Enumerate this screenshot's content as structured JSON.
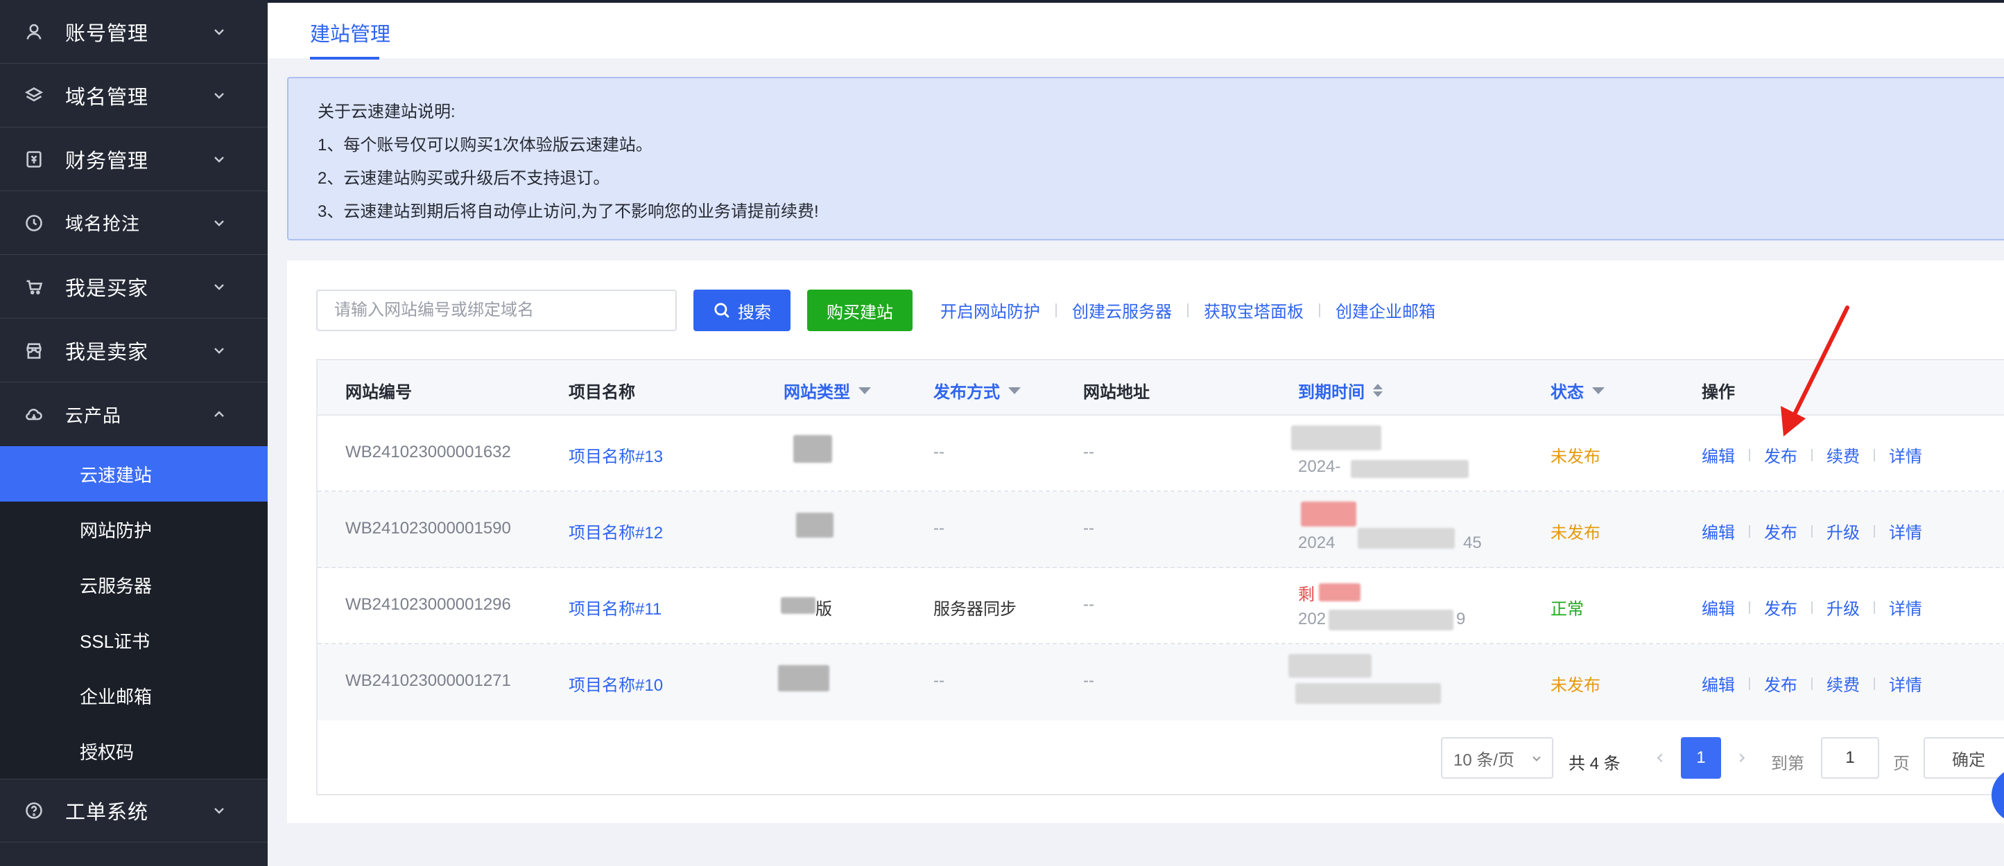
{
  "sidebar": {
    "items": [
      {
        "label": "账号管理",
        "icon": "user-icon"
      },
      {
        "label": "域名管理",
        "icon": "layers-icon"
      },
      {
        "label": "财务管理",
        "icon": "finance-icon"
      },
      {
        "label": "域名抢注",
        "icon": "clock-icon"
      },
      {
        "label": "我是买家",
        "icon": "cart-icon"
      },
      {
        "label": "我是卖家",
        "icon": "store-icon"
      },
      {
        "label": "云产品",
        "icon": "cloud-icon"
      }
    ],
    "sub_items": [
      "云速建站",
      "网站防护",
      "云服务器",
      "SSL证书",
      "企业邮箱",
      "授权码"
    ],
    "active_sub": "云速建站",
    "footer_item": {
      "label": "工单系统",
      "icon": "help-icon"
    }
  },
  "header": {
    "tab": "建站管理"
  },
  "notice": {
    "lines": [
      "关于云速建站说明:",
      "1、每个账号仅可以购买1次体验版云速建站。",
      "2、云速建站购买或升级后不支持退订。",
      "3、云速建站到期后将自动停止访问,为了不影响您的业务请提前续费!"
    ]
  },
  "toolbar": {
    "search_placeholder": "请输入网站编号或绑定域名",
    "search_label": "搜索",
    "buy_label": "购买建站",
    "links": [
      "开启网站防护",
      "创建云服务器",
      "获取宝塔面板",
      "创建企业邮箱"
    ]
  },
  "table": {
    "headers": [
      "网站编号",
      "项目名称",
      "网站类型",
      "发布方式",
      "网站地址",
      "到期时间",
      "状态",
      "操作"
    ],
    "rows": [
      {
        "id": "WB241023000001632",
        "name": "项目名称#13",
        "type": "",
        "publish": "--",
        "url": "--",
        "expire_line1": "",
        "expire_line2": "2024-",
        "status": "未发布",
        "status_color": "#e59a0e",
        "ops": [
          "编辑",
          "发布",
          "续费",
          "详情"
        ]
      },
      {
        "id": "WB241023000001590",
        "name": "项目名称#12",
        "type": "",
        "publish": "--",
        "url": "--",
        "expire_line1": "",
        "expire_line2": "2024",
        "expire_tail": "45",
        "status": "未发布",
        "status_color": "#e59a0e",
        "ops": [
          "编辑",
          "发布",
          "升级",
          "详情"
        ]
      },
      {
        "id": "WB241023000001296",
        "name": "项目名称#11",
        "type": "版",
        "publish": "服务器同步",
        "url": "--",
        "expire_line1": "剩",
        "expire_line2": "202",
        "expire_tail": "9",
        "status": "正常",
        "status_color": "#1eaa1e",
        "ops": [
          "编辑",
          "发布",
          "升级",
          "详情"
        ]
      },
      {
        "id": "WB241023000001271",
        "name": "项目名称#10",
        "type": "",
        "publish": "--",
        "url": "--",
        "expire_line1": "",
        "expire_line2": "",
        "status": "未发布",
        "status_color": "#e59a0e",
        "ops": [
          "编辑",
          "发布",
          "续费",
          "详情"
        ]
      }
    ]
  },
  "pagination": {
    "page_size": "10 条/页",
    "total": "共 4 条",
    "current": "1",
    "goto_label": "到第",
    "goto_value": "1",
    "page_label": "页",
    "confirm_label": "确定"
  },
  "colors": {
    "accent": "#2f64f0",
    "sidebar_bg": "#232834",
    "buy_green": "#1eaa1e",
    "annotation_arrow": "#e8211a"
  }
}
